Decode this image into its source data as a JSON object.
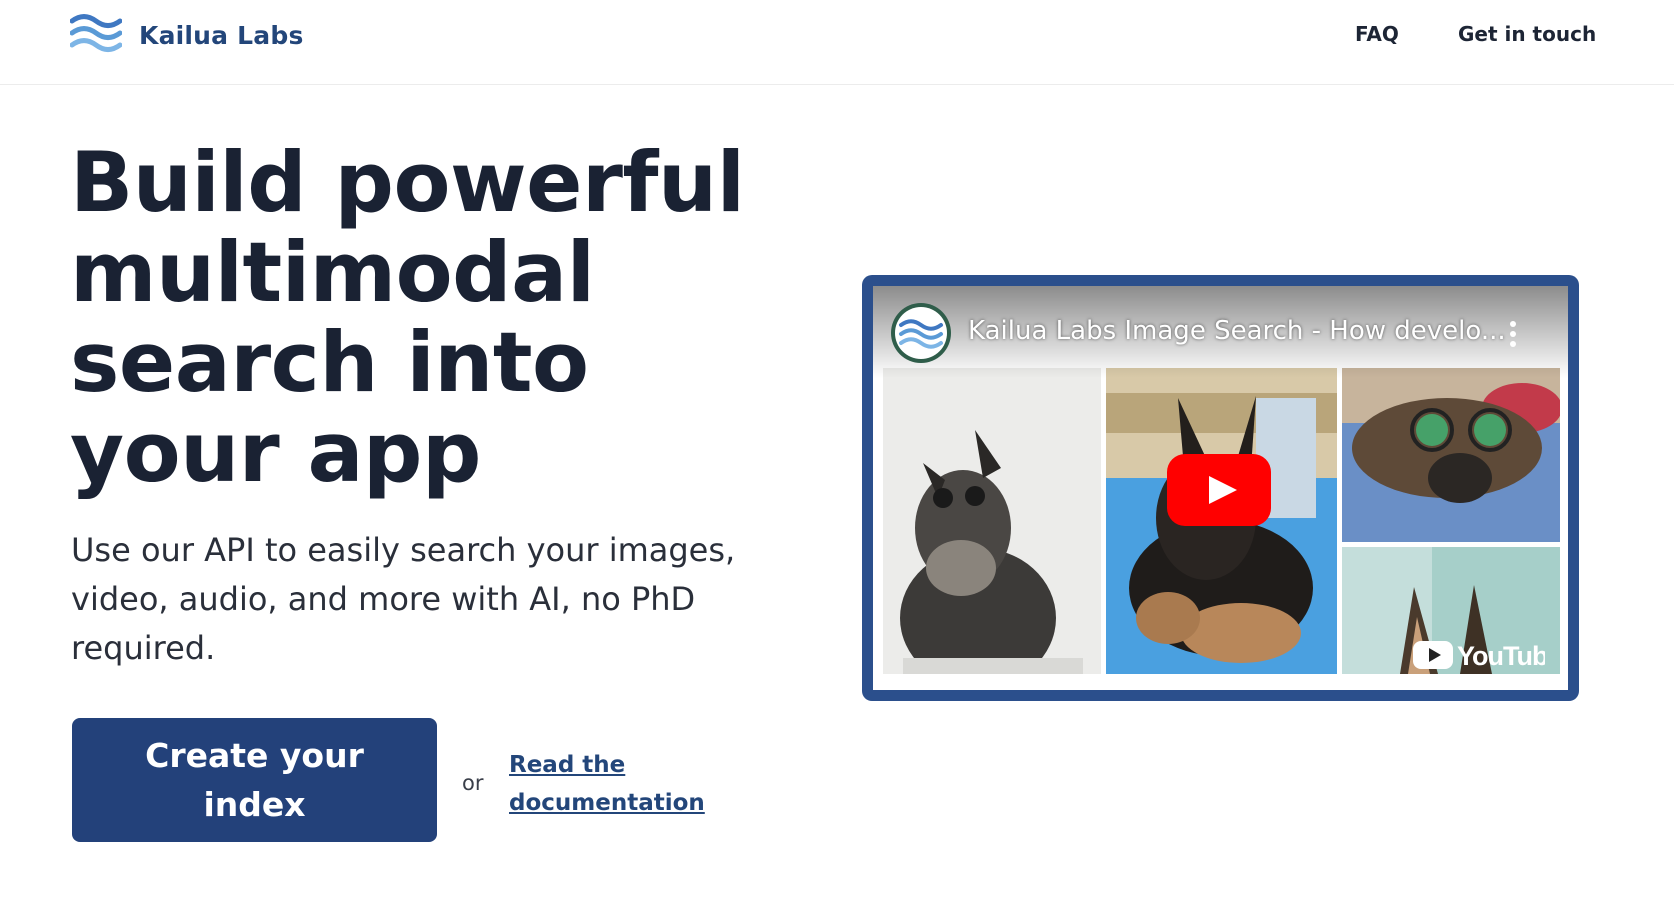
{
  "header": {
    "brand": "Kailua Labs",
    "logo_icon": "waves-logo-icon",
    "nav": [
      {
        "label": "FAQ"
      },
      {
        "label": "Get in touch"
      }
    ]
  },
  "hero": {
    "headline": "Build powerful multimodal search into your app",
    "subtext": "Use our API to easily search your images, video, audio, and more with AI, no PhD required.",
    "cta_label": "Create your index",
    "or_text": "or",
    "doc_link_label": "Read the documentation"
  },
  "video": {
    "title": "Kailua Labs Image Search - How develo...",
    "channel_icon": "kailua-labs-avatar-icon",
    "play_icon": "youtube-play-icon",
    "menu_icon": "more-vert-icon",
    "brand_icon": "youtube-logo-icon",
    "thumbnails": [
      "dog-with-sunglasses-1",
      "dog-on-cushion",
      "dog-with-glasses-lying",
      "dog-ears"
    ]
  },
  "colors": {
    "brand_navy": "#23417a",
    "frame_blue": "#2b4f8c",
    "youtube_red": "#ff0000"
  }
}
